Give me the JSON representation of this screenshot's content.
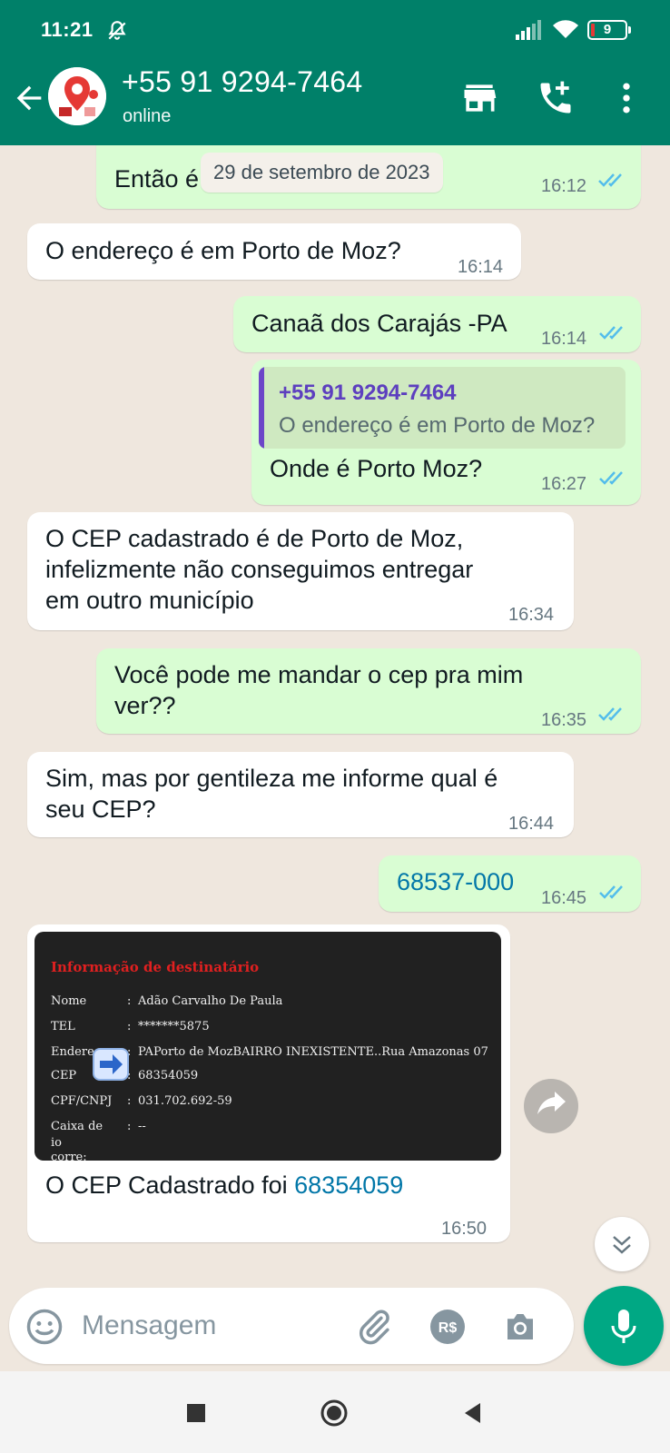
{
  "status_bar": {
    "time": "11:21",
    "battery": "9"
  },
  "header": {
    "contact_name": "+55 91 9294-7464",
    "contact_status": "online",
    "icons": [
      "back-arrow-icon",
      "store-icon",
      "add-call-icon",
      "more-vert-icon"
    ]
  },
  "chat": {
    "date_chip": "29 de setembro de 2023",
    "messages": [
      {
        "direction": "out",
        "text": "Então é nesse mesmo",
        "time": "16:12",
        "read": true
      },
      {
        "direction": "in",
        "text": "O endereço é em Porto de Moz?",
        "time": "16:14"
      },
      {
        "direction": "out",
        "text": "Canaã dos Carajás -PA",
        "time": "16:14",
        "read": true
      },
      {
        "direction": "out",
        "quote": {
          "name": "+55 91 9294-7464",
          "text": "O endereço é em Porto de Moz?"
        },
        "text": "Onde é Porto Moz?",
        "time": "16:27",
        "read": true
      },
      {
        "direction": "in",
        "lines": [
          "O CEP cadastrado é de Porto de Moz,",
          "infelizmente não conseguimos entregar",
          "em outro município"
        ],
        "time": "16:34"
      },
      {
        "direction": "out",
        "lines": [
          "Você pode me mandar o cep pra mim",
          "ver??"
        ],
        "time": "16:35",
        "read": true
      },
      {
        "direction": "in",
        "lines": [
          "Sim, mas por gentileza me informe qual é",
          "seu CEP?"
        ],
        "time": "16:44"
      },
      {
        "direction": "out",
        "text": "68537-000",
        "time": "16:45",
        "read": true
      },
      {
        "direction": "in",
        "card": {
          "title": "Informação de destinatário",
          "rows": [
            {
              "label": "Nome",
              "value": "Adão Carvalho De Paula"
            },
            {
              "label": "TEL",
              "value": "*******5875"
            },
            {
              "label": "Endereço",
              "value": "PAPorto de MozBAIRRO INEXISTENTE..Rua Amazonas 07"
            },
            {
              "label": "CEP",
              "value": "68354059"
            },
            {
              "label": "CPF/CNPJ",
              "value": "031.702.692-59"
            },
            {
              "label": "Caixa de corre:",
              "label2": "io",
              "value": "--"
            }
          ]
        },
        "caption_prefix": "O CEP Cadastrado foi ",
        "caption_link": "68354059",
        "time": "16:50"
      }
    ]
  },
  "composer": {
    "placeholder": "Mensagem"
  },
  "colors": {
    "header": "#008069",
    "outgoing_bubble": "#dcf8c6",
    "incoming_bubble": "#ffffff",
    "mic_button": "#00a884",
    "read_ticks": "#53bdeb"
  }
}
